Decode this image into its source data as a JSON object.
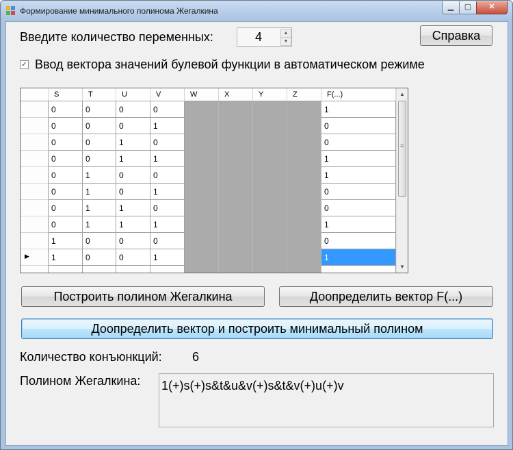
{
  "window": {
    "title": "Формирование минимального полинома Жегалкина",
    "controls": {
      "minimize": "▁",
      "maximize": "▢",
      "close": "✕"
    }
  },
  "form": {
    "var_count_label": "Введите количество переменных:",
    "var_count_value": "4",
    "help_button": "Справка",
    "auto_mode_label": "Ввод вектора значений булевой функции в автоматическом режиме",
    "auto_mode_checked": true,
    "build_button": "Построить полином Жегалкина",
    "complete_button": "Доопределить вектор F(...)",
    "complete_build_button": "Доопределить вектор и построить минимальный полином",
    "conj_label": "Количество конъюнкций:",
    "conj_value": "6",
    "poly_label": "Полином Жегалкина:",
    "poly_value": "1(+)s(+)s&t&u&v(+)s&t&v(+)u(+)v"
  },
  "table": {
    "columns": [
      "S",
      "T",
      "U",
      "V",
      "W",
      "X",
      "Y",
      "Z",
      "F(...)"
    ],
    "active_columns": 4,
    "rows": [
      {
        "vals": [
          "0",
          "0",
          "0",
          "0"
        ],
        "f": "1"
      },
      {
        "vals": [
          "0",
          "0",
          "0",
          "1"
        ],
        "f": "0"
      },
      {
        "vals": [
          "0",
          "0",
          "1",
          "0"
        ],
        "f": "0"
      },
      {
        "vals": [
          "0",
          "0",
          "1",
          "1"
        ],
        "f": "1"
      },
      {
        "vals": [
          "0",
          "1",
          "0",
          "0"
        ],
        "f": "1"
      },
      {
        "vals": [
          "0",
          "1",
          "0",
          "1"
        ],
        "f": "0"
      },
      {
        "vals": [
          "0",
          "1",
          "1",
          "0"
        ],
        "f": "0"
      },
      {
        "vals": [
          "0",
          "1",
          "1",
          "1"
        ],
        "f": "1"
      },
      {
        "vals": [
          "1",
          "0",
          "0",
          "0"
        ],
        "f": "0"
      },
      {
        "vals": [
          "1",
          "0",
          "0",
          "1"
        ],
        "f": "1",
        "current": true,
        "selected_f": true
      }
    ]
  },
  "colors": {
    "selection": "#3399ff",
    "disabled_cells": "#ababab",
    "window_frame": "#a9c3e0"
  }
}
